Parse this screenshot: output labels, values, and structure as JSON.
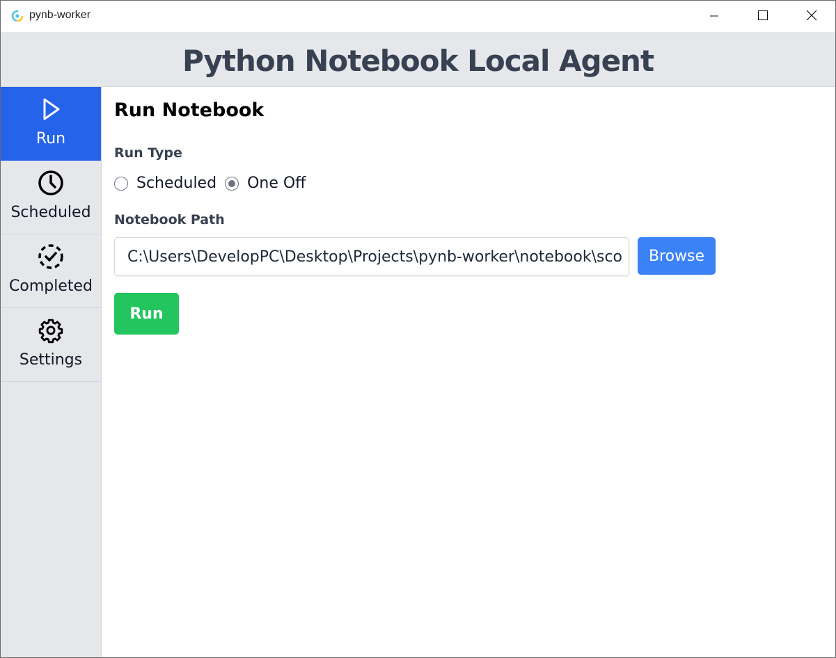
{
  "window": {
    "title": "pynb-worker",
    "app_icon": "pynb-worker-logo-icon",
    "controls": [
      "minimize-icon",
      "maximize-icon",
      "close-icon"
    ]
  },
  "header": {
    "title": "Python Notebook Local Agent"
  },
  "sidebar": {
    "items": [
      {
        "label": "Run",
        "icon": "play-icon",
        "active": true
      },
      {
        "label": "Scheduled",
        "icon": "clock-icon",
        "active": false
      },
      {
        "label": "Completed",
        "icon": "dashed-check-circle-icon",
        "active": false
      },
      {
        "label": "Settings",
        "icon": "gear-icon",
        "active": false
      }
    ]
  },
  "main": {
    "title": "Run Notebook",
    "run_type": {
      "label": "Run Type",
      "options": [
        {
          "label": "Scheduled",
          "checked": false
        },
        {
          "label": "One Off",
          "checked": true
        }
      ]
    },
    "notebook_path": {
      "label": "Notebook Path",
      "value": "C:\\Users\\DevelopPC\\Desktop\\Projects\\pynb-worker\\notebook\\sco"
    },
    "browse_label": "Browse",
    "run_label": "Run"
  },
  "colors": {
    "active_nav": "#2563eb",
    "browse_button": "#3b82f6",
    "run_button": "#22c55e",
    "header_bg": "#e5e7eb",
    "header_text": "#374151"
  }
}
